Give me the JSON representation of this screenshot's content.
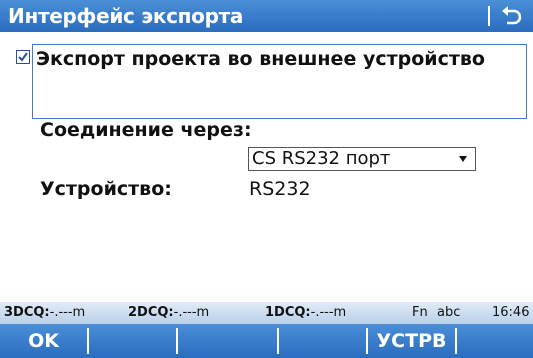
{
  "titlebar": {
    "title": "Интерфейс экспорта",
    "back_icon": "return-arrow-icon"
  },
  "export_option": {
    "checked": true,
    "label": "Экспорт проекта во внешнее устройство"
  },
  "form": {
    "connection_label": "Соединение через:",
    "connection_value": "CS RS232 порт",
    "device_label": "Устройство:",
    "device_value": "RS232"
  },
  "status": {
    "dcq3_label": "3DCQ:",
    "dcq3_value": "-.---m",
    "dcq2_label": "2DCQ:",
    "dcq2_value": "-.---m",
    "dcq1_label": "1DCQ:",
    "dcq1_value": "-.---m",
    "fn": "Fn",
    "input_mode": "abc",
    "time": "16:46"
  },
  "softkeys": {
    "f1": "OK",
    "f2": "",
    "f3": "",
    "f4": "",
    "f5": "УСТРВ",
    "f6": ""
  }
}
